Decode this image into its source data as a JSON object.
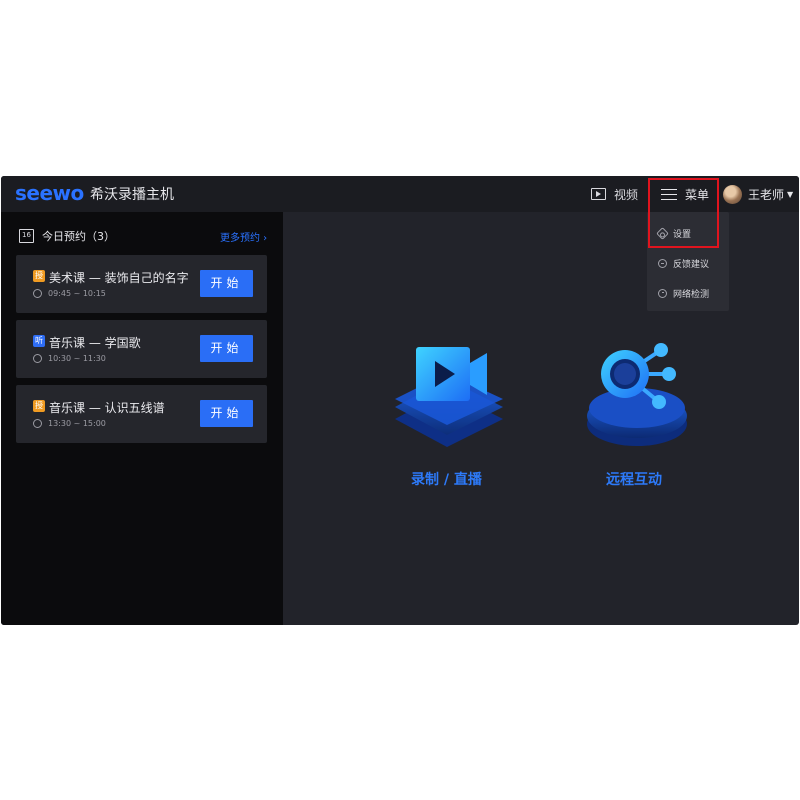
{
  "header": {
    "logo": "seewo",
    "app_title": "希沃录播主机",
    "video_label": "视频",
    "menu_label": "菜单",
    "user_name": "王老师"
  },
  "dropdown": {
    "items": [
      {
        "label": "设置",
        "icon": "gear-icon"
      },
      {
        "label": "反馈建议",
        "icon": "feedback-icon"
      },
      {
        "label": "网络检测",
        "icon": "network-icon"
      }
    ]
  },
  "schedule": {
    "calendar_day": "16",
    "title": "今日预约（3）",
    "more_link": "更多预约 ›",
    "courses": [
      {
        "tag": "授",
        "tag_color": "#f09b22",
        "title": "美术课 — 装饰自己的名字",
        "time": "09:45 ~ 10:15",
        "button": "开始"
      },
      {
        "tag": "听",
        "tag_color": "#2e6df5",
        "title": "音乐课 — 学国歌",
        "time": "10:30 ~ 11:30",
        "button": "开始"
      },
      {
        "tag": "授",
        "tag_color": "#f09b22",
        "title": "音乐课 — 认识五线谱",
        "time": "13:30 ~ 15:00",
        "button": "开始"
      }
    ]
  },
  "features": {
    "record_label": "录制 / 直播",
    "remote_label": "远程互动"
  },
  "colors": {
    "accent": "#2a72ff",
    "highlight_box": "#e0141e",
    "background": "#22232a"
  }
}
